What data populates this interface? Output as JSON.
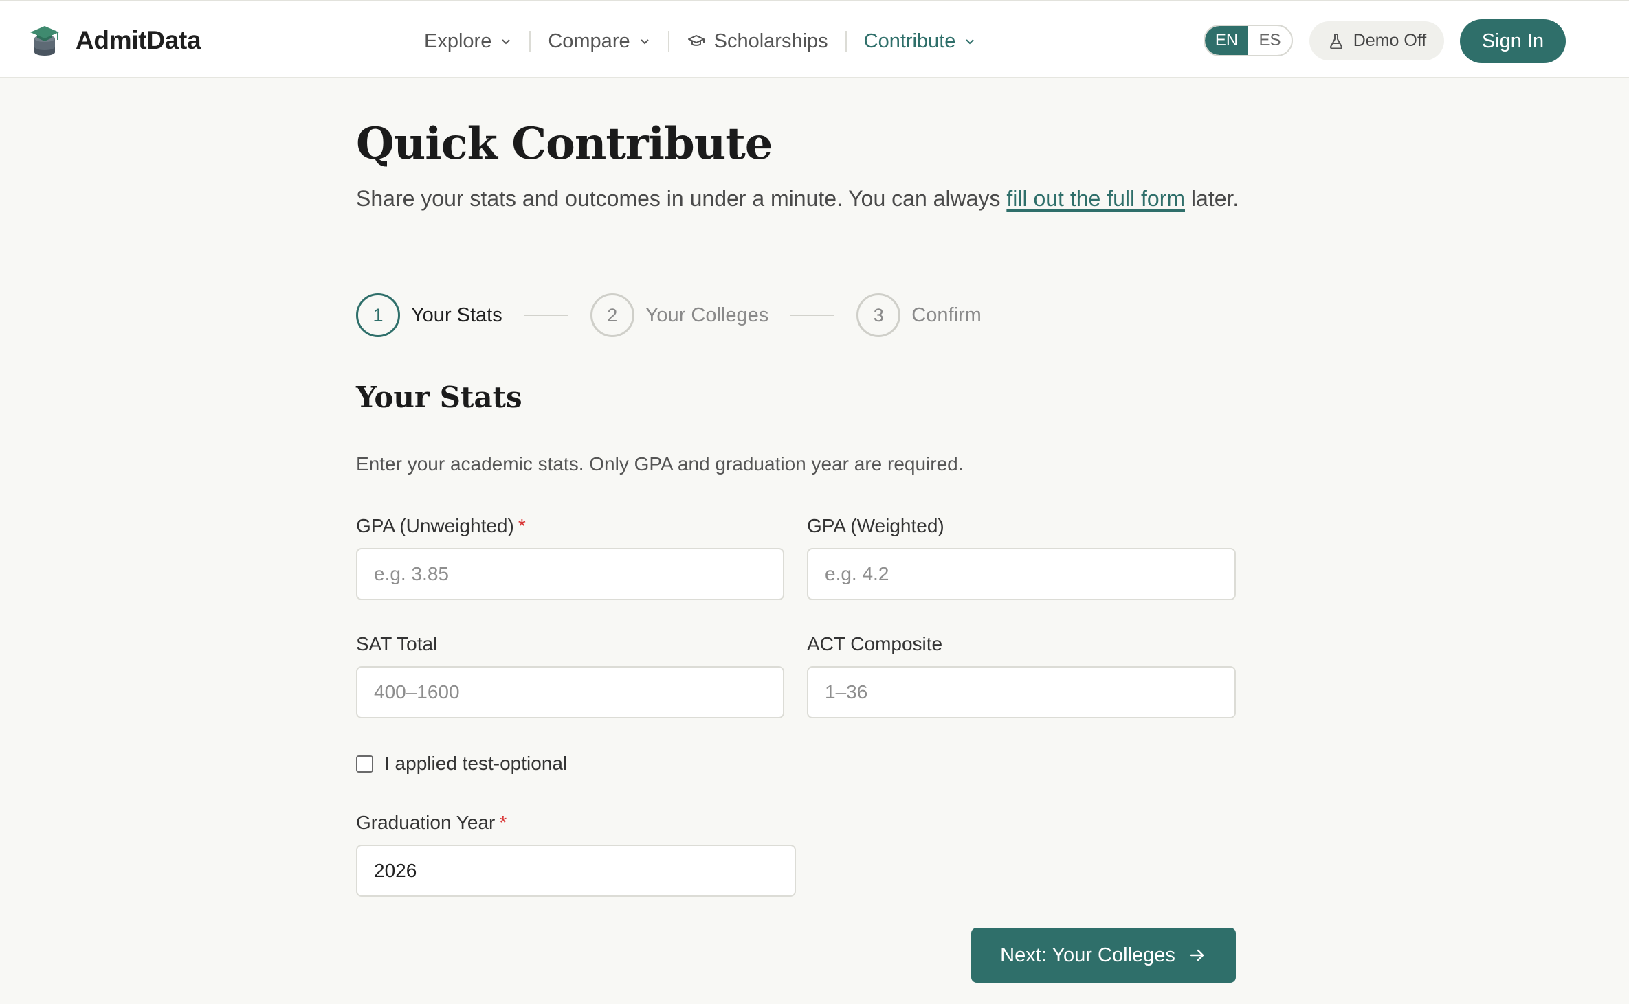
{
  "brand": {
    "name": "AdmitData",
    "logo_icon": "graduation-cap-database-icon"
  },
  "nav": {
    "items": [
      {
        "label": "Explore",
        "has_dropdown": true,
        "active": false
      },
      {
        "label": "Compare",
        "has_dropdown": true,
        "active": false
      },
      {
        "label": "Scholarships",
        "icon": "graduation-cap-icon",
        "has_dropdown": false,
        "active": false
      },
      {
        "label": "Contribute",
        "has_dropdown": true,
        "active": true
      }
    ]
  },
  "language": {
    "options": [
      "EN",
      "ES"
    ],
    "selected": "EN"
  },
  "demo": {
    "label": "Demo Off",
    "icon": "flask-icon"
  },
  "auth": {
    "sign_in_label": "Sign In"
  },
  "page": {
    "title": "Quick Contribute",
    "lead_before": "Share your stats and outcomes in under a minute. You can always ",
    "lead_link": "fill out the full form",
    "lead_after": " later."
  },
  "steps": [
    {
      "number": "1",
      "label": "Your Stats",
      "current": true
    },
    {
      "number": "2",
      "label": "Your Colleges",
      "current": false
    },
    {
      "number": "3",
      "label": "Confirm",
      "current": false
    }
  ],
  "section": {
    "title": "Your Stats",
    "description": "Enter your academic stats. Only GPA and graduation year are required."
  },
  "fields": {
    "gpa_unweighted": {
      "label": "GPA (Unweighted)",
      "required": true,
      "placeholder": "e.g. 3.85",
      "value": ""
    },
    "gpa_weighted": {
      "label": "GPA (Weighted)",
      "required": false,
      "placeholder": "e.g. 4.2",
      "value": ""
    },
    "sat_total": {
      "label": "SAT Total",
      "required": false,
      "placeholder": "400–1600",
      "value": ""
    },
    "act_composite": {
      "label": "ACT Composite",
      "required": false,
      "placeholder": "1–36",
      "value": ""
    },
    "test_optional": {
      "label": "I applied test-optional",
      "checked": false
    },
    "graduation_year": {
      "label": "Graduation Year",
      "required": true,
      "placeholder": "",
      "value": "2026"
    }
  },
  "actions": {
    "next_label": "Next: Your Colleges",
    "next_icon": "arrow-right-icon"
  },
  "colors": {
    "accent": "#2f6f6a",
    "required": "#d93636",
    "background": "#f8f8f5"
  }
}
